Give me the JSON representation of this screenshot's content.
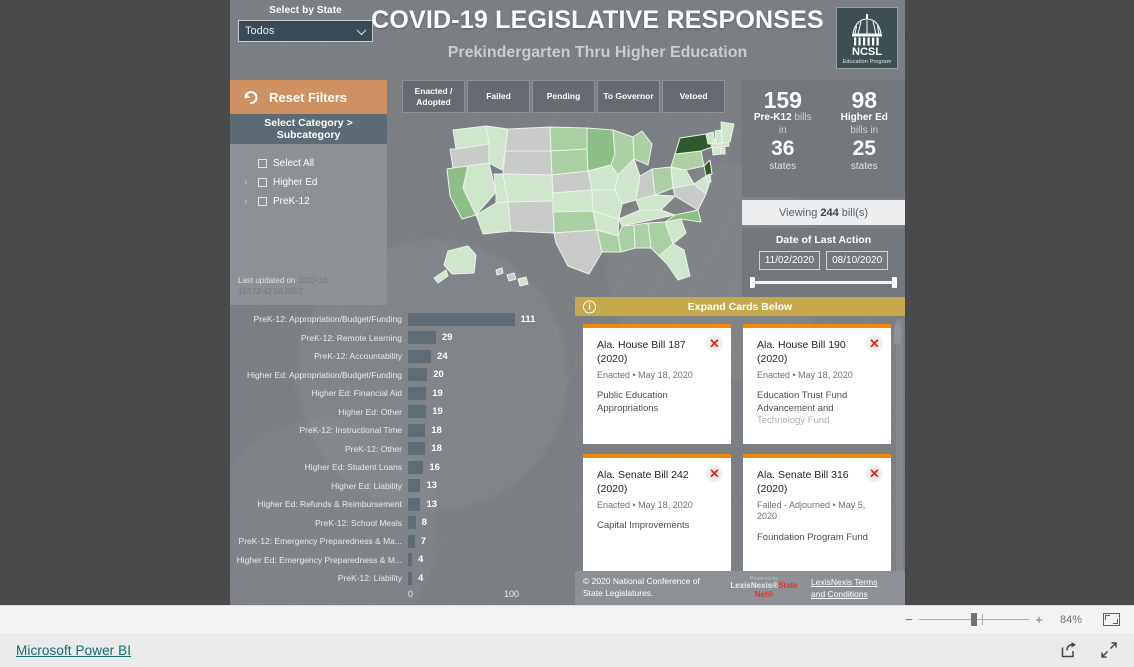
{
  "header": {
    "select_state_label": "Select by State",
    "state_value": "Todos",
    "title": "COVID-19 LEGISLATIVE RESPONSES",
    "subtitle": "Prekindergarten Thru Higher Education",
    "logo_name": "NCSL",
    "logo_sub": "Education Program"
  },
  "filters": {
    "reset_label": "Reset Filters",
    "category_header": "Select Category > Subcategory",
    "items": [
      {
        "label": "Select All",
        "expandable": false
      },
      {
        "label": "Higher Ed",
        "expandable": true
      },
      {
        "label": "PreK-12",
        "expandable": true
      }
    ],
    "last_updated_prefix": "Last updated on ",
    "last_updated_value": "2020-10-19T22:42:58.000Z."
  },
  "status_tabs": [
    {
      "label": "Enacted / Adopted"
    },
    {
      "label": "Failed"
    },
    {
      "label": "Pending"
    },
    {
      "label": "To Governor"
    },
    {
      "label": "Vetoed"
    }
  ],
  "kpi": {
    "prek12_count": "159",
    "prek12_label_1": "Pre-K12",
    "prek12_label_2": "bills",
    "prek12_label_3": "in",
    "prek12_states": "36",
    "higher_count": "98",
    "higher_label_1": "Higher Ed",
    "higher_label_2": "bills in",
    "higher_states": "25",
    "states_word": "states",
    "viewing_prefix": "Viewing",
    "viewing_count": "244",
    "viewing_suffix": "bill(s)",
    "date_title": "Date of Last Action",
    "date_start": "11/02/2020",
    "date_end": "08/10/2020"
  },
  "chart_data": {
    "type": "bar",
    "orientation": "horizontal",
    "title": "",
    "xlabel": "",
    "ylabel": "",
    "xlim": [
      0,
      125
    ],
    "xticks": [
      "0",
      "100"
    ],
    "grid": true,
    "categories": [
      "PreK-12: Appropriation/Budget/Funding",
      "PreK-12: Remote Learning",
      "PreK-12: Accountability",
      "Higher Ed: Appropriation/Budget/Funding",
      "Higher Ed: Financial Aid",
      "Higher Ed: Other",
      "PreK-12: Instructional Time",
      "PreK-12: Other",
      "Higher Ed: Student Loans",
      "Higher Ed: Liability",
      "Higher Ed: Refunds & Reimbursement",
      "PreK-12: School Meals",
      "PreK-12: Emergency Preparedness & Ma...",
      "Higher Ed: Emergency Preparedness & M...",
      "PreK-12: Liability"
    ],
    "values": [
      111,
      29,
      24,
      20,
      19,
      19,
      18,
      18,
      16,
      13,
      13,
      8,
      7,
      4,
      4
    ]
  },
  "cards": {
    "expand_label": "Expand Cards Below",
    "items": [
      {
        "title": "Ala. House Bill 187 (2020)",
        "status": "Enacted • May 18, 2020",
        "desc": "Public Education Appropriations",
        "desc_faded": ""
      },
      {
        "title": "Ala. House Bill 190 (2020)",
        "status": "Enacted • May 18, 2020",
        "desc": "Education Trust Fund Advancement and ",
        "desc_faded": "Technology Fund"
      },
      {
        "title": "Ala. Senate Bill 242 (2020)",
        "status": "Enacted • May 18, 2020",
        "desc": "Capital Improvements",
        "desc_faded": ""
      },
      {
        "title": "Ala. Senate Bill 316 (2020)",
        "status": "Failed - Adjourned • May 5, 2020",
        "desc": "Foundation Program Fund",
        "desc_faded": ""
      }
    ]
  },
  "footer": {
    "copyright": "© 2020 National Conference of State Legislatures.",
    "powered_by": "Powered by",
    "lexis_name": "LexisNexis®",
    "lexis_name2": "State Net®",
    "terms_link": "LexisNexis Terms and Conditions"
  },
  "toolbar": {
    "zoom_minus": "−",
    "zoom_plus": "+",
    "zoom_percent": "84%"
  },
  "statusbar": {
    "powerbi_label": "Microsoft Power BI"
  },
  "map": {
    "colors": {
      "nodata": "#c9cbc9",
      "light": "#cfe6cc",
      "mid": "#abd0a4",
      "dark": "#8bbf86",
      "darkest": "#2d5a2c"
    }
  }
}
